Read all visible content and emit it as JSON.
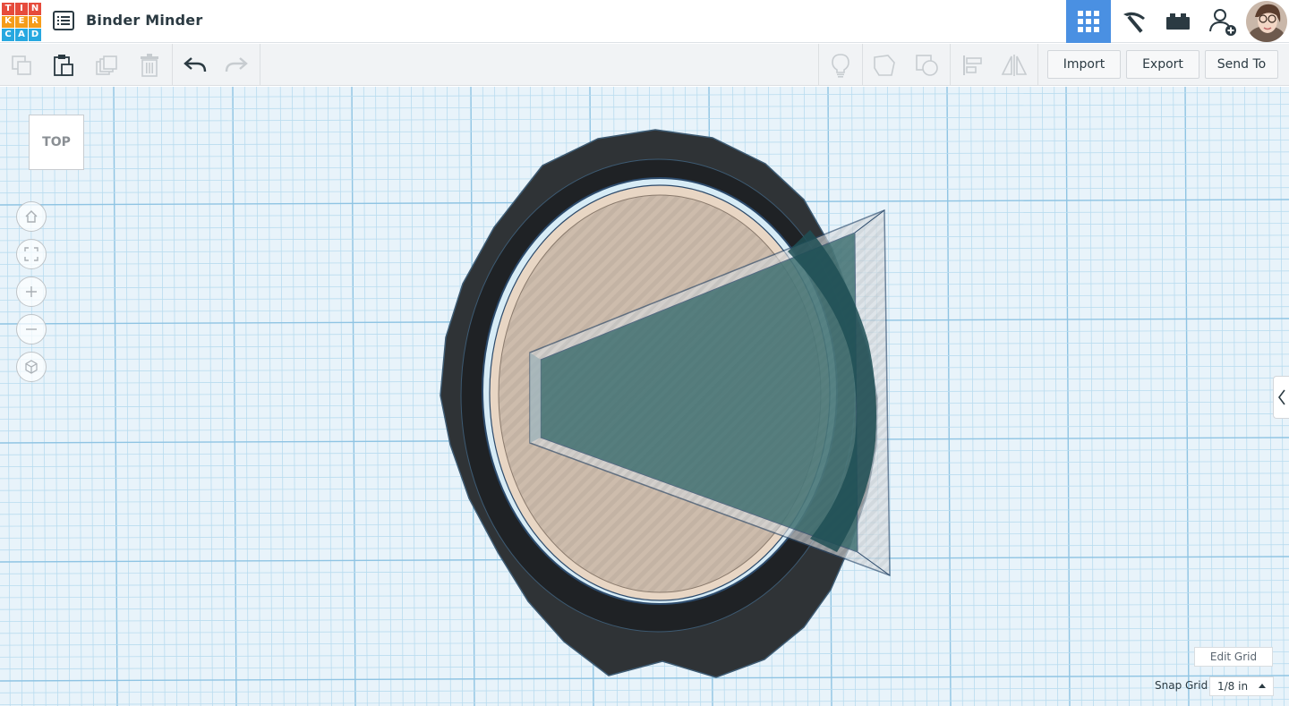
{
  "app": {
    "logo_letters": [
      "T",
      "I",
      "N",
      "K",
      "E",
      "R",
      "C",
      "A",
      "D"
    ],
    "logo_colors": [
      "#e64b3c",
      "#e64b3c",
      "#e64b3c",
      "#f59c1a",
      "#f59c1a",
      "#f59c1a",
      "#27a8e0",
      "#27a8e0",
      "#27a8e0"
    ],
    "project_title": "Binder Minder"
  },
  "header": {
    "buttons": [
      {
        "name": "3d-design-view-button",
        "icon": "grid-view-icon",
        "active": true
      },
      {
        "name": "blocks-view-button",
        "icon": "pickaxe-icon",
        "active": false
      },
      {
        "name": "bricks-view-button",
        "icon": "brick-icon",
        "active": false
      },
      {
        "name": "add-collaborator-button",
        "icon": "add-user-icon",
        "active": false
      }
    ],
    "accent_color": "#4a90e2"
  },
  "toolbar": {
    "copy_icon": "copy-icon",
    "paste_icon": "paste-icon",
    "duplicate_icon": "duplicate-icon",
    "delete_icon": "trash-icon",
    "undo_icon": "undo-icon",
    "redo_icon": "redo-icon",
    "show_all_icon": "lightbulb-icon",
    "group_icon": "group-icon",
    "ungroup_icon": "ungroup-icon",
    "align_icon": "align-icon",
    "mirror_icon": "mirror-icon",
    "import_label": "Import",
    "export_label": "Export",
    "send_to_label": "Send To"
  },
  "workplane": {
    "view_cube_label": "TOP",
    "nav": [
      "home-icon",
      "fit-view-icon",
      "zoom-in-icon",
      "zoom-out-icon",
      "perspective-icon"
    ],
    "edit_grid_label": "Edit Grid",
    "snap_grid_label": "Snap Grid",
    "snap_grid_value": "1/8 in"
  }
}
